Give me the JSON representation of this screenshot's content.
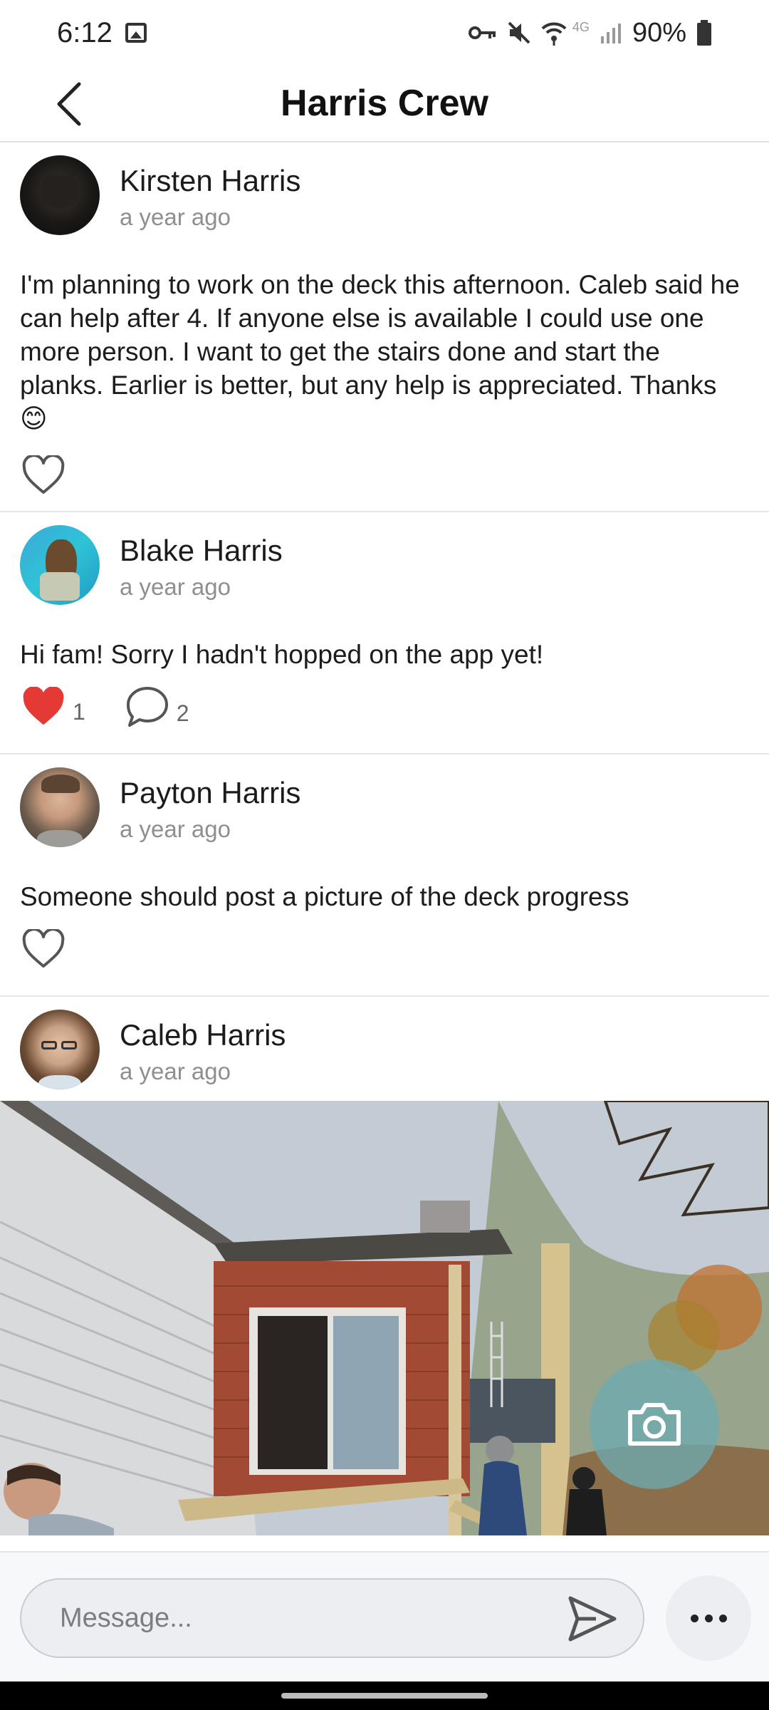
{
  "status_bar": {
    "time": "6:12",
    "network": "4G",
    "battery": "90%",
    "icons": [
      "image-icon",
      "vpn-key-icon",
      "mute-icon",
      "wifi-icon",
      "signal-icon",
      "battery-icon"
    ]
  },
  "header": {
    "title": "Harris Crew",
    "back_icon": "chevron-left-icon"
  },
  "posts": [
    {
      "author": "Kirsten Harris",
      "time": "a year ago",
      "text": "I'm planning to work on the deck this afternoon.  Caleb said he can help after 4. If anyone else is available I could use one more person.  I want to get the stairs done and start the planks. Earlier is better, but any help is appreciated.  Thanks 😊",
      "liked": false
    },
    {
      "author": "Blake Harris",
      "time": "a year ago",
      "text": "Hi fam! Sorry I hadn't hopped on the app yet!",
      "liked": true,
      "likes": "1",
      "comments": "2"
    },
    {
      "author": "Payton Harris",
      "time": "a year ago",
      "text": "Someone should post a picture of the deck progress",
      "liked": false
    },
    {
      "author": "Caleb Harris",
      "time": "a year ago",
      "has_photo": true
    }
  ],
  "composer": {
    "placeholder": "Message...",
    "send_icon": "send-icon",
    "more_icon": "more-horizontal-icon"
  },
  "fab": {
    "icon": "camera-icon"
  },
  "colors": {
    "like_red": "#e53935",
    "fab_teal": "#6eaaaf",
    "divider": "#e6e6e6",
    "muted_text": "#8f8f8f"
  }
}
